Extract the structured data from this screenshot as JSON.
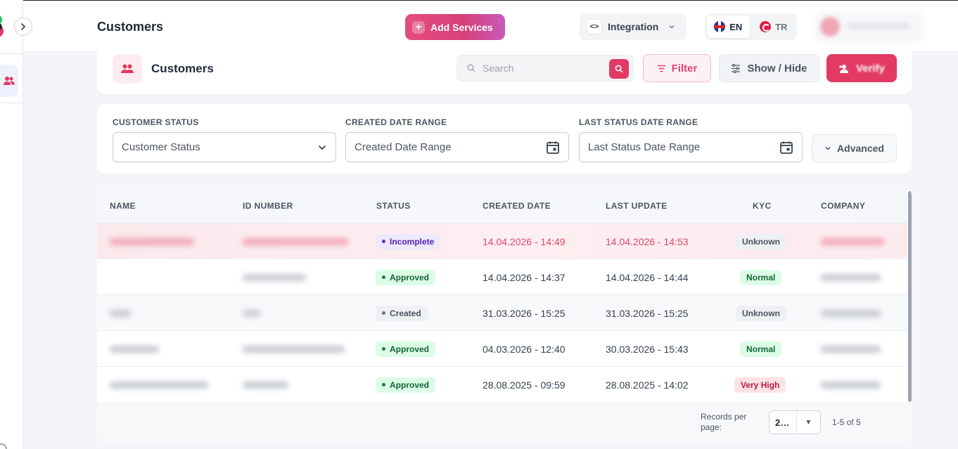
{
  "header": {
    "title": "Customers",
    "add_services": "Add Services",
    "integration": "Integration",
    "languages": [
      {
        "code": "EN",
        "active": true
      },
      {
        "code": "TR",
        "active": false
      }
    ]
  },
  "toolbar": {
    "title": "Customers",
    "search_placeholder": "Search",
    "filter_label": "Filter",
    "show_hide_label": "Show / Hide",
    "verify_label": "Verify"
  },
  "filters": {
    "customer_status": {
      "label": "CUSTOMER STATUS",
      "placeholder": "Customer Status"
    },
    "created_date_range": {
      "label": "CREATED DATE RANGE",
      "placeholder": "Created Date Range"
    },
    "last_status_date_range": {
      "label": "LAST STATUS DATE RANGE",
      "placeholder": "Last Status Date Range"
    },
    "advanced_label": "Advanced"
  },
  "table": {
    "columns": [
      "NAME",
      "ID NUMBER",
      "STATUS",
      "CREATED DATE",
      "LAST UPDATE",
      "KYC",
      "COMPANY"
    ],
    "rows": [
      {
        "status": "Incomplete",
        "created": "14.04.2026 - 14:49",
        "updated": "14.04.2026 - 14:53",
        "kyc": "Unknown"
      },
      {
        "status": "Approved",
        "created": "14.04.2026 - 14:37",
        "updated": "14.04.2026 - 14:44",
        "kyc": "Normal"
      },
      {
        "status": "Created",
        "created": "31.03.2026 - 15:25",
        "updated": "31.03.2026 - 15:25",
        "kyc": "Unknown"
      },
      {
        "status": "Approved",
        "created": "04.03.2026 - 12:40",
        "updated": "30.03.2026 - 15:43",
        "kyc": "Normal"
      },
      {
        "status": "Approved",
        "created": "28.08.2025 - 09:59",
        "updated": "28.08.2025 - 14:02",
        "kyc": "Very High"
      }
    ]
  },
  "pagination": {
    "records_per_page_label": "Records per page:",
    "records_per_page_value": "2…",
    "range": "1-5 of 5"
  },
  "colors": {
    "accent": "#e23a64",
    "incomplete": "#6d28d9",
    "approved": "#15803d",
    "very_high": "#b91c3c"
  }
}
